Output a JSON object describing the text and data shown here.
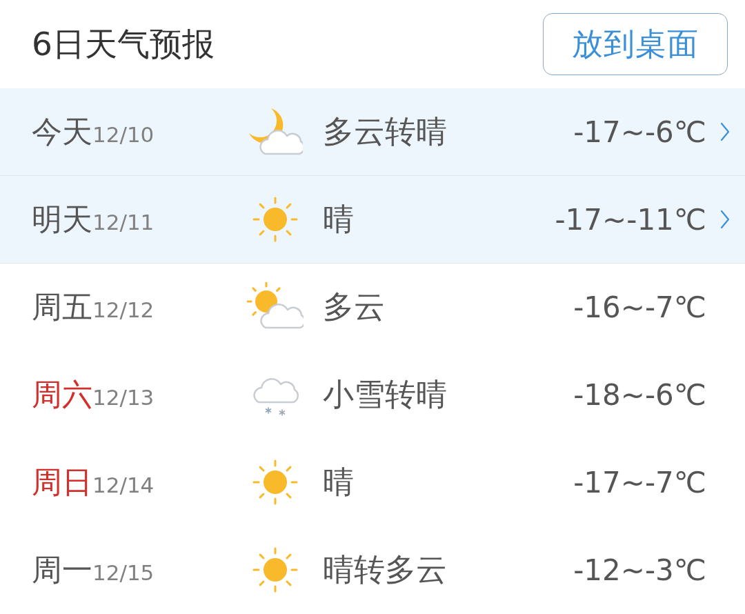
{
  "header": {
    "title": "6日天气预报",
    "button": "放到桌面"
  },
  "days": [
    {
      "day": "今天",
      "date": "12/10",
      "weekend": false,
      "kind": "moon-cloud",
      "condition": "多云转晴",
      "temperature": "-17~-6℃",
      "highlighted": true
    },
    {
      "day": "明天",
      "date": "12/11",
      "weekend": false,
      "kind": "sun",
      "condition": "晴",
      "temperature": "-17~-11℃",
      "highlighted": true
    },
    {
      "day": "周五",
      "date": "12/12",
      "weekend": false,
      "kind": "sun-cloud",
      "condition": "多云",
      "temperature": "-16~-7℃",
      "highlighted": false
    },
    {
      "day": "周六",
      "date": "12/13",
      "weekend": true,
      "kind": "snow-cloud",
      "condition": "小雪转晴",
      "temperature": "-18~-6℃",
      "highlighted": false
    },
    {
      "day": "周日",
      "date": "12/14",
      "weekend": true,
      "kind": "sun",
      "condition": "晴",
      "temperature": "-17~-7℃",
      "highlighted": false
    },
    {
      "day": "周一",
      "date": "12/15",
      "weekend": false,
      "kind": "sun",
      "condition": "晴转多云",
      "temperature": "-12~-3℃",
      "highlighted": false
    }
  ]
}
